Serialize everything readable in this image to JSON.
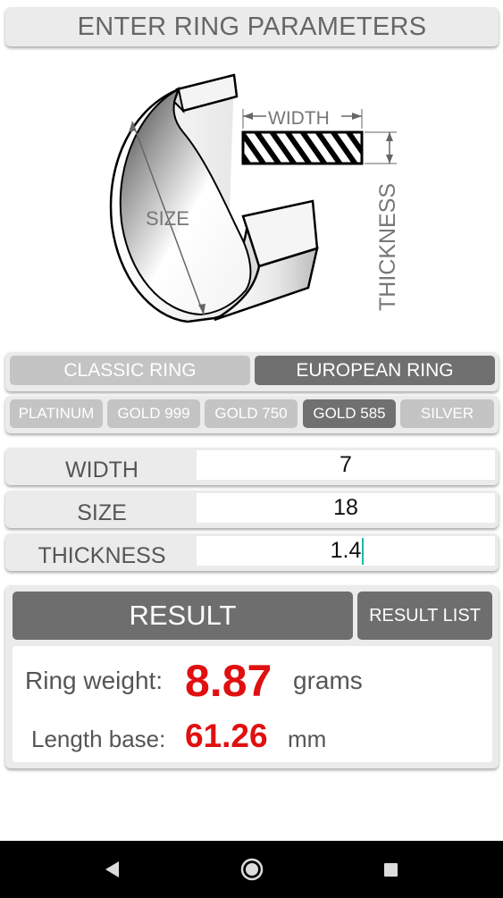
{
  "header": {
    "title": "ENTER RING PARAMETERS"
  },
  "diagram": {
    "width_label": "WIDTH",
    "size_label": "SIZE",
    "thickness_label": "THICKNESS"
  },
  "ring_type": {
    "options": [
      "CLASSIC RING",
      "EUROPEAN RING"
    ],
    "selected": "EUROPEAN RING"
  },
  "metal": {
    "options": [
      "PLATINUM",
      "GOLD 999",
      "GOLD 750",
      "GOLD 585",
      "SILVER"
    ],
    "selected": "GOLD 585"
  },
  "params": {
    "width": {
      "label": "WIDTH",
      "value": "7"
    },
    "size": {
      "label": "SIZE",
      "value": "18"
    },
    "thickness": {
      "label": "THICKNESS",
      "value": "1.4"
    }
  },
  "result": {
    "button_label": "RESULT",
    "list_button_label": "RESULT LIST",
    "weight_label": "Ring weight:",
    "weight_value": "8.87",
    "weight_unit": "grams",
    "length_label": "Length base:",
    "length_value": "61.26",
    "length_unit": "mm"
  },
  "colors": {
    "accent_value": "#e01010",
    "active_segment": "#707070",
    "inactive_segment": "#c4c4c4",
    "cursor": "#1fb8a8"
  },
  "nav": {
    "icons": [
      "back-icon",
      "home-icon",
      "recents-icon"
    ]
  }
}
